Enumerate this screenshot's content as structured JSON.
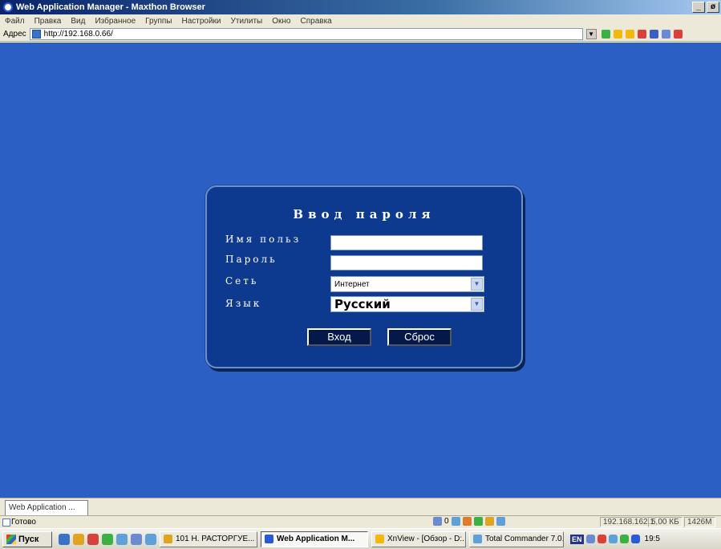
{
  "window": {
    "title": "Web Application Manager - Maxthon Browser",
    "buttons": {
      "minimize": "_",
      "restore": "ø"
    }
  },
  "menu": [
    "Файл",
    "Правка",
    "Вид",
    "Избранное",
    "Группы",
    "Настройки",
    "Утилиты",
    "Окно",
    "Справка"
  ],
  "address": {
    "label": "Адрес",
    "url": "http://192.168.0.66/"
  },
  "login": {
    "title": "Ввод пароля",
    "username_label": "Имя польз",
    "password_label": "Пароль",
    "network_label": "Сеть",
    "language_label": "Язык",
    "username_value": "",
    "password_value": "",
    "network_value": "Интернет",
    "language_value": "Русский",
    "login_button": "Вход",
    "reset_button": "Сброс"
  },
  "tabs": [
    "Web Application ..."
  ],
  "status": {
    "text": "Готово",
    "counter": "0",
    "ip": "192.168.162.1",
    "size": "5,00 КБ",
    "memory": "1426M"
  },
  "taskbar": {
    "start": "Пуск",
    "tasks": [
      "101 Н. РАСТОРГУЕ...",
      "Web Application M...",
      "XnView - [Обзор - D:...",
      "Total Commander 7.0..."
    ],
    "language": "EN",
    "clock": "19:5"
  }
}
